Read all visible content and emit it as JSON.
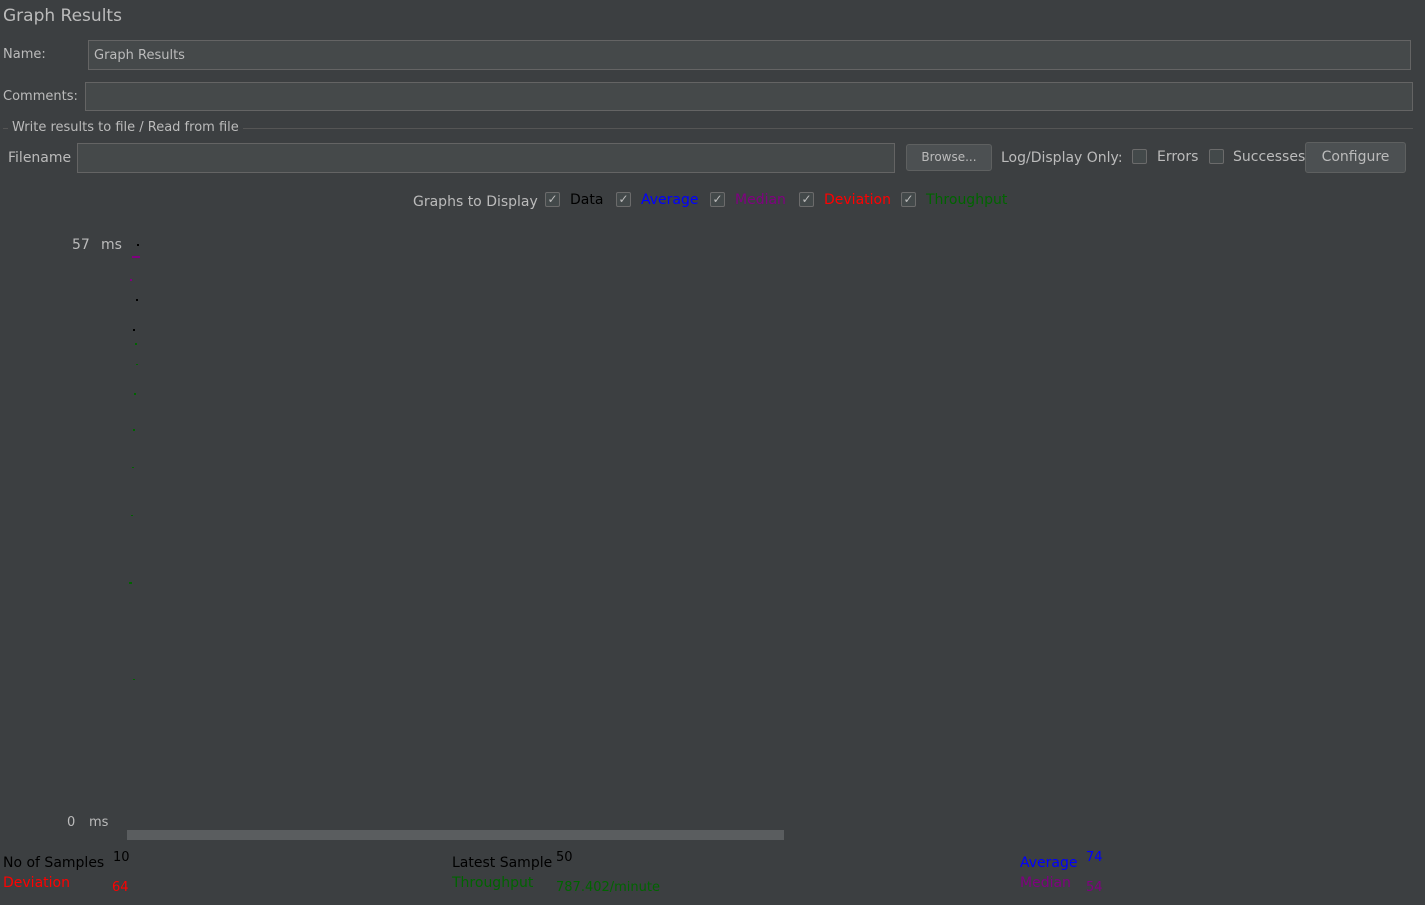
{
  "panel": {
    "title": "Graph Results"
  },
  "form": {
    "name_label": "Name:",
    "name_value": "Graph Results",
    "comments_label": "Comments:",
    "comments_value": ""
  },
  "file_section": {
    "legend": "Write results to file / Read from file",
    "filename_label": "Filename",
    "filename_value": "",
    "browse_label": "Browse...",
    "log_display_label": "Log/Display Only:",
    "errors_label": "Errors",
    "errors_checked": false,
    "successes_label": "Successes",
    "successes_checked": false,
    "configure_label": "Configure"
  },
  "graphs_to_display": {
    "label": "Graphs to Display",
    "options": [
      {
        "label": "Data",
        "checked": true,
        "color": "#000000"
      },
      {
        "label": "Average",
        "checked": true,
        "color": "#0000ff"
      },
      {
        "label": "Median",
        "checked": true,
        "color": "#800080"
      },
      {
        "label": "Deviation",
        "checked": true,
        "color": "#ff0000"
      },
      {
        "label": "Throughput",
        "checked": true,
        "color": "#006400"
      }
    ]
  },
  "graph": {
    "y_max_value": "57",
    "y_max_unit": "ms",
    "y_min_value": "0",
    "y_min_unit": "ms"
  },
  "stats": {
    "no_of_samples_label": "No of Samples",
    "no_of_samples_value": "10",
    "deviation_label": "Deviation",
    "deviation_value": "64",
    "latest_sample_label": "Latest Sample",
    "latest_sample_value": "50",
    "throughput_label": "Throughput",
    "throughput_value": "787.402/minute",
    "average_label": "Average",
    "average_value": "74",
    "median_label": "Median",
    "median_value": "54"
  },
  "colors": {
    "background": "#3c3f41",
    "text": "#bbbbbb",
    "data": "#000000",
    "average": "#0000ff",
    "median": "#800080",
    "deviation": "#ff0000",
    "throughput": "#006400"
  }
}
